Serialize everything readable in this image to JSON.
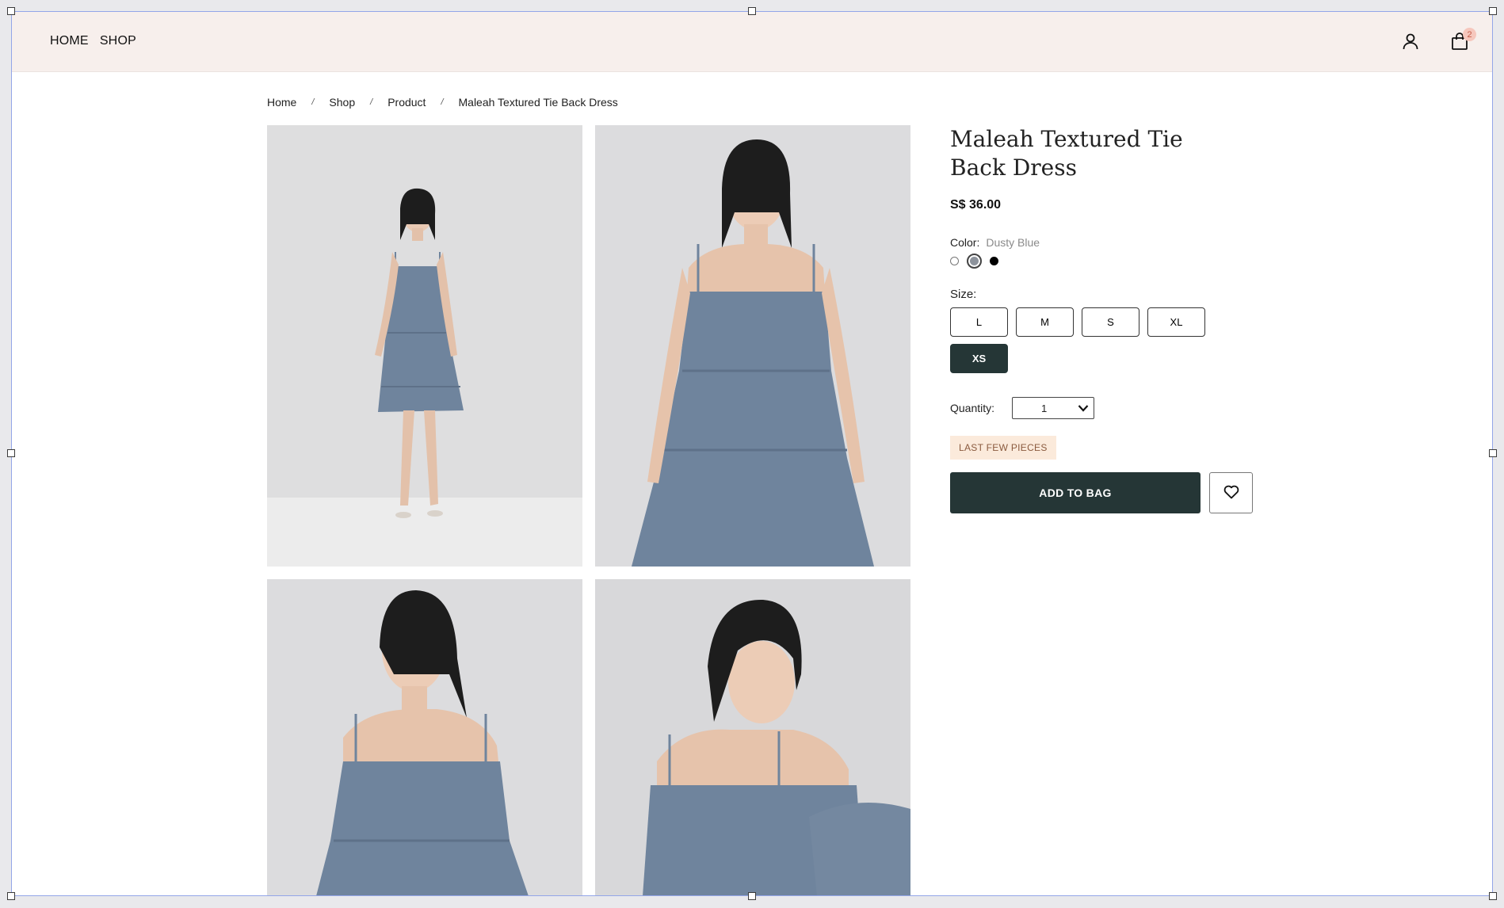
{
  "nav": {
    "home": "HOME",
    "shop": "SHOP"
  },
  "header": {
    "cart_count": "2"
  },
  "breadcrumb": [
    "Home",
    "Shop",
    "Product",
    "Maleah Textured Tie Back Dress"
  ],
  "breadcrumb_sep": "/",
  "product": {
    "title": "Maleah Textured Tie Back Dress",
    "price": "S$ 36.00",
    "color_label": "Color:",
    "color_selected": "Dusty Blue",
    "swatches": [
      {
        "color": "#ffffff",
        "name": "white"
      },
      {
        "color": "#8d939c",
        "name": "dusty-blue"
      },
      {
        "color": "#000000",
        "name": "black"
      }
    ],
    "size_label": "Size:",
    "sizes": [
      "L",
      "M",
      "S",
      "XL",
      "XS"
    ],
    "size_selected": "XS",
    "quantity_label": "Quantity:",
    "quantity_value": "1",
    "stock_badge": "LAST FEW PIECES",
    "add_to_bag": "ADD TO BAG"
  },
  "colors": {
    "header_bg": "#f7efec",
    "primary_dark": "#253636",
    "dress": "#6f849d",
    "badge_bg": "#fbeadb"
  }
}
